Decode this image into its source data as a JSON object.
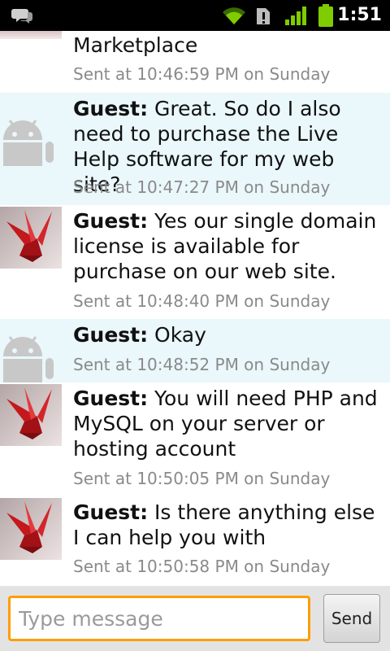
{
  "status_bar": {
    "time": "1:51",
    "icons": [
      "chat-notification-icon",
      "wifi-icon",
      "notification-alert-icon",
      "signal-icon",
      "battery-icon"
    ]
  },
  "messages": [
    {
      "author": "",
      "text": "Marketplace",
      "time": "Sent at 10:46:59 PM on Sunday",
      "avatar": "none"
    },
    {
      "author": "Guest:",
      "text": " Great.  So do I also need to purchase the Live Help software for my web site?",
      "time": "Sent at 10:47:27 PM on Sunday",
      "avatar": "android"
    },
    {
      "author": "Guest:",
      "text": " Yes our single domain license is available for purchase on our web site.",
      "time": "Sent at 10:48:40 PM on Sunday",
      "avatar": "origami-crane"
    },
    {
      "author": "Guest:",
      "text": " Okay",
      "time": "Sent at 10:48:52 PM on Sunday",
      "avatar": "android"
    },
    {
      "author": "Guest:",
      "text": " You will need PHP and MySQL on your server or hosting account",
      "time": "Sent at 10:50:05 PM on Sunday",
      "avatar": "origami-crane"
    },
    {
      "author": "Guest:",
      "text": " Is there anything else I can help you with",
      "time": "Sent at 10:50:58 PM on Sunday",
      "avatar": "origami-crane"
    }
  ],
  "input": {
    "placeholder": "Type message",
    "value": ""
  },
  "send_button": {
    "label": "Send"
  },
  "colors": {
    "accent_focus": "#ff9d00",
    "alt_row": "#eaf7fb",
    "timestamp": "#8a8a8a",
    "android_green": "#a4c639"
  }
}
